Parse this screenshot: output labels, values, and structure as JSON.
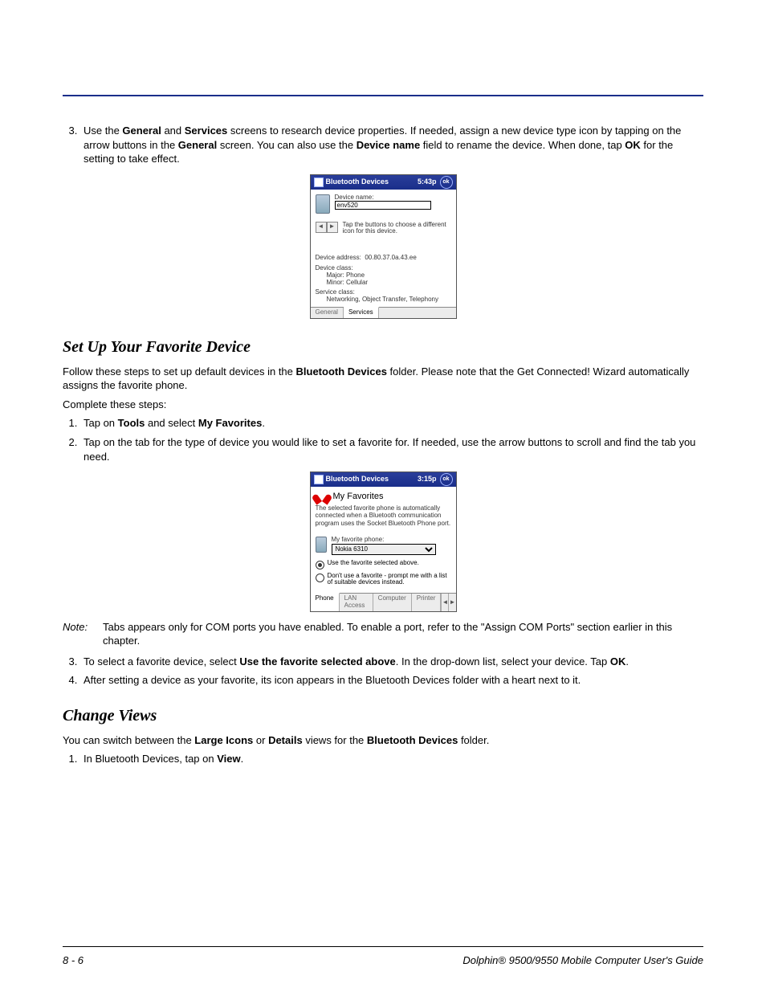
{
  "step3": {
    "pre": "Use the ",
    "b1": "General",
    "mid1": " and ",
    "b2": "Services",
    "mid2": " screens to research device properties. If needed, assign a new device type icon by tapping on the arrow buttons in the ",
    "b3": "General",
    "mid3": " screen. You can also use the ",
    "b4": "Device name",
    "mid4": " field to rename the device. When done, tap ",
    "b5": "OK",
    "post": " for the setting to take effect."
  },
  "fig1": {
    "title": "Bluetooth Devices",
    "time": "5:43p",
    "ok": "ok",
    "devname_label": "Device name:",
    "devname_value": "env520",
    "icon_hint": "Tap the buttons to choose a different icon for this device.",
    "addr_label": "Device address:",
    "addr_value": "00.80.37.0a.43.ee",
    "devclass_label": "Device class:",
    "major": "Major:  Phone",
    "minor": "Minor:  Cellular",
    "svcclass_label": "Service class:",
    "svcclass_value": "Networking, Object Transfer, Telephony",
    "tab_general": "General",
    "tab_services": "Services"
  },
  "sec1_title": "Set Up Your Favorite Device",
  "sec1_p1_pre": "Follow these steps to set up default devices in the ",
  "sec1_p1_b": "Bluetooth Devices",
  "sec1_p1_post": " folder. Please note that the Get Connected! Wizard automatically assigns the favorite phone.",
  "sec1_p2": "Complete these steps:",
  "sec1_li1_pre": "Tap on ",
  "sec1_li1_b1": "Tools",
  "sec1_li1_mid": " and select ",
  "sec1_li1_b2": "My Favorites",
  "sec1_li1_post": ".",
  "sec1_li2": "Tap on the tab for the type of device you would like to set a favorite for. If needed, use the arrow buttons to scroll and find the tab you need.",
  "fig2": {
    "title": "Bluetooth Devices",
    "time": "3:15p",
    "ok": "ok",
    "myfav": "My Favorites",
    "para": "The selected favorite phone is automatically connected when a Bluetooth communication program uses the Socket Bluetooth Phone port.",
    "favlabel": "My favorite phone:",
    "favvalue": "Nokia 6310",
    "radio1": "Use the favorite selected above.",
    "radio2": "Don't use a favorite - prompt me with a list of suitable devices instead.",
    "tabs": [
      "Phone",
      "LAN Access",
      "Computer",
      "Printer"
    ]
  },
  "note_label": "Note:",
  "note_text": "Tabs appears only for COM ports you have enabled. To enable a port, refer to the \"Assign COM Ports\" section earlier in this chapter.",
  "sec1_li3_pre": "To select a favorite device, select ",
  "sec1_li3_b1": "Use the favorite selected above",
  "sec1_li3_mid": ". In the drop-down list, select your device. Tap ",
  "sec1_li3_b2": "OK",
  "sec1_li3_post": ".",
  "sec1_li4": "After setting a device as your favorite, its icon appears in the Bluetooth Devices folder with a heart next to it.",
  "sec2_title": "Change Views",
  "sec2_p1_pre": "You can switch between the ",
  "sec2_p1_b1": "Large Icons",
  "sec2_p1_mid1": " or ",
  "sec2_p1_b2": "Details",
  "sec2_p1_mid2": " views for the ",
  "sec2_p1_b3": "Bluetooth Devices",
  "sec2_p1_post": " folder.",
  "sec2_li1_pre": "In Bluetooth Devices, tap on ",
  "sec2_li1_b": "View",
  "sec2_li1_post": ".",
  "footer_left": "8 - 6",
  "footer_right": "Dolphin® 9500/9550 Mobile Computer User's Guide"
}
